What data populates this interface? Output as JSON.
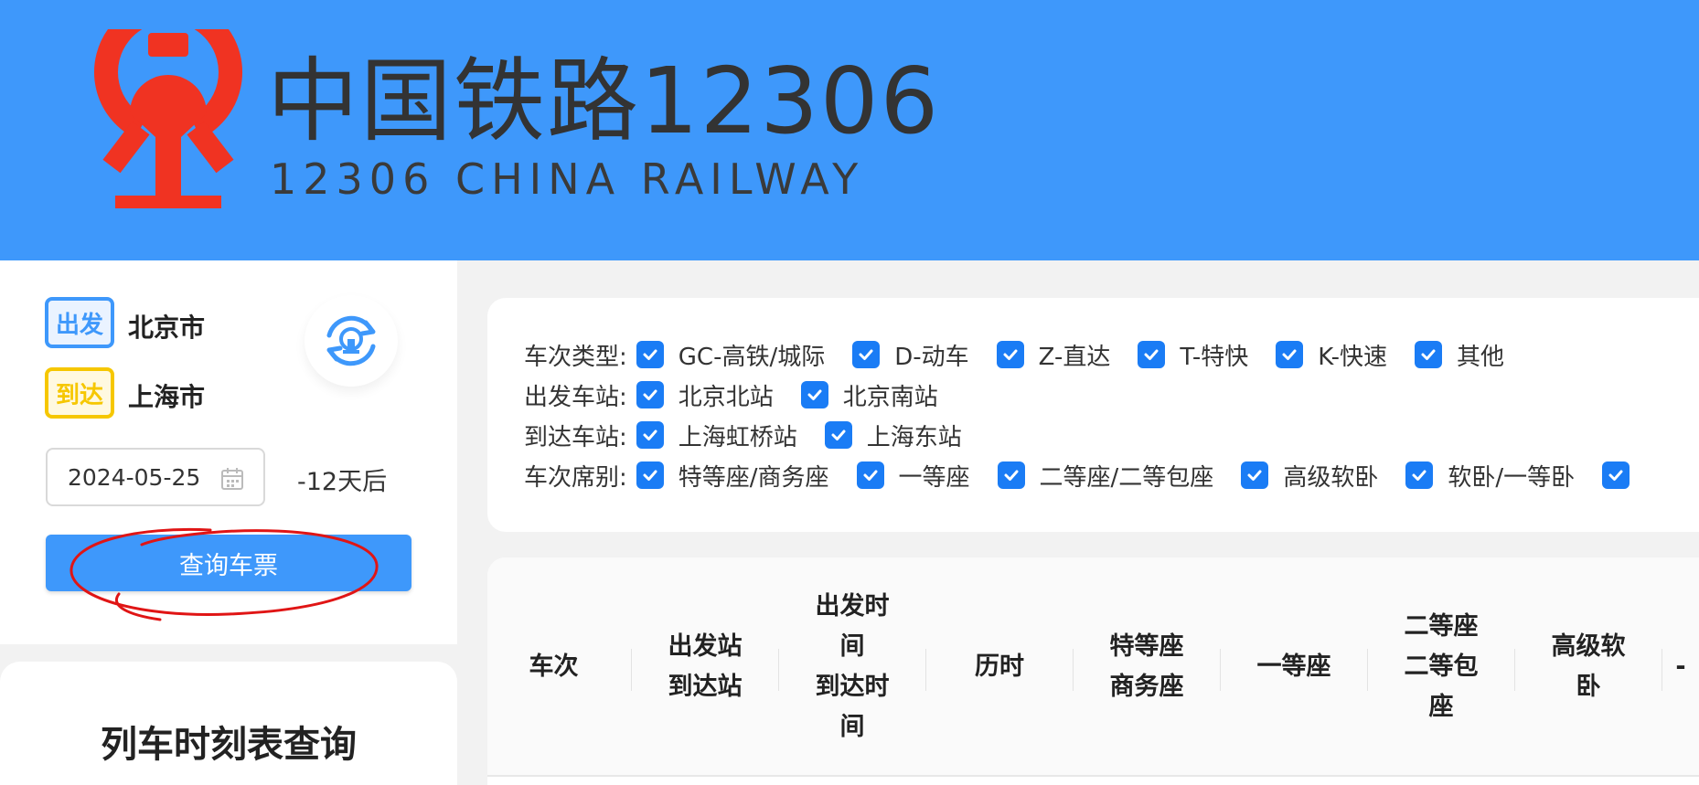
{
  "header": {
    "logo_title": "中国铁路12306",
    "logo_subtitle": "12306 CHINA RAILWAY",
    "logo_icon": "china-railway-emblem",
    "bg_color": "#3e98fb",
    "emblem_color": "#f03322"
  },
  "search": {
    "departure_badge": "出发",
    "departure_city": "北京市",
    "arrival_badge": "到达",
    "arrival_city": "上海市",
    "swap_icon": "swap-stations-icon",
    "date": "2024-05-25",
    "calendar_icon": "calendar-icon",
    "date_offset": "-12天后",
    "query_button": "查询车票"
  },
  "schedule": {
    "title": "列车时刻表查询"
  },
  "filters": {
    "train_type": {
      "label": "车次类型:",
      "options": [
        "GC-高铁/城际",
        "D-动车",
        "Z-直达",
        "T-特快",
        "K-快速",
        "其他"
      ]
    },
    "departure_station": {
      "label": "出发车站:",
      "options": [
        "北京北站",
        "北京南站"
      ]
    },
    "arrival_station": {
      "label": "到达车站:",
      "options": [
        "上海虹桥站",
        "上海东站"
      ]
    },
    "seat_class": {
      "label": "车次席别:",
      "options": [
        "特等座/商务座",
        "一等座",
        "二等座/二等包座",
        "高级软卧",
        "软卧/一等卧"
      ]
    },
    "checked_color": "#1a7cf5"
  },
  "table": {
    "headers": {
      "train_no": "车次",
      "dep_station": "出发站",
      "arr_station": "到达站",
      "dep_time_1": "出发时",
      "dep_time_2": "间",
      "arr_time_1": "到达时",
      "arr_time_2": "间",
      "duration": "历时",
      "business_1": "特等座",
      "business_2": "商务座",
      "first": "一等座",
      "second_1": "二等座",
      "second_2": "二等包",
      "second_3": "座",
      "soft_1": "高级软",
      "soft_2": "卧",
      "partial": "-"
    }
  }
}
